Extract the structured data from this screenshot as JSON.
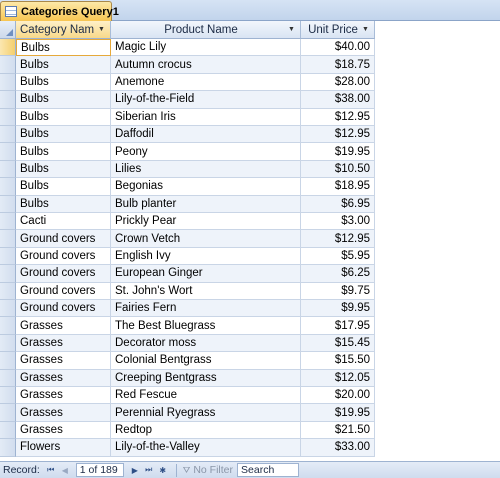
{
  "tab": {
    "title": "Categories Query1"
  },
  "columns": [
    {
      "label": "Category Nam"
    },
    {
      "label": "Product Name"
    },
    {
      "label": "Unit Price"
    }
  ],
  "rows": [
    [
      "Bulbs",
      "Magic Lily",
      "$40.00"
    ],
    [
      "Bulbs",
      "Autumn crocus",
      "$18.75"
    ],
    [
      "Bulbs",
      "Anemone",
      "$28.00"
    ],
    [
      "Bulbs",
      "Lily-of-the-Field",
      "$38.00"
    ],
    [
      "Bulbs",
      "Siberian Iris",
      "$12.95"
    ],
    [
      "Bulbs",
      "Daffodil",
      "$12.95"
    ],
    [
      "Bulbs",
      "Peony",
      "$19.95"
    ],
    [
      "Bulbs",
      "Lilies",
      "$10.50"
    ],
    [
      "Bulbs",
      "Begonias",
      "$18.95"
    ],
    [
      "Bulbs",
      "Bulb planter",
      "$6.95"
    ],
    [
      "Cacti",
      "Prickly Pear",
      "$3.00"
    ],
    [
      "Ground covers",
      "Crown Vetch",
      "$12.95"
    ],
    [
      "Ground covers",
      "English Ivy",
      "$5.95"
    ],
    [
      "Ground covers",
      "European Ginger",
      "$6.25"
    ],
    [
      "Ground covers",
      "St. John's Wort",
      "$9.75"
    ],
    [
      "Ground covers",
      "Fairies Fern",
      "$9.95"
    ],
    [
      "Grasses",
      "The Best Bluegrass",
      "$17.95"
    ],
    [
      "Grasses",
      "Decorator moss",
      "$15.45"
    ],
    [
      "Grasses",
      "Colonial Bentgrass",
      "$15.50"
    ],
    [
      "Grasses",
      "Creeping Bentgrass",
      "$12.05"
    ],
    [
      "Grasses",
      "Red Fescue",
      "$20.00"
    ],
    [
      "Grasses",
      "Perennial Ryegrass",
      "$19.95"
    ],
    [
      "Grasses",
      "Redtop",
      "$21.50"
    ],
    [
      "Flowers",
      "Lily-of-the-Valley",
      "$33.00"
    ]
  ],
  "navigator": {
    "record_label": "Record:",
    "position": "1 of 189",
    "filter_label": "No Filter",
    "search_label": "Search"
  }
}
